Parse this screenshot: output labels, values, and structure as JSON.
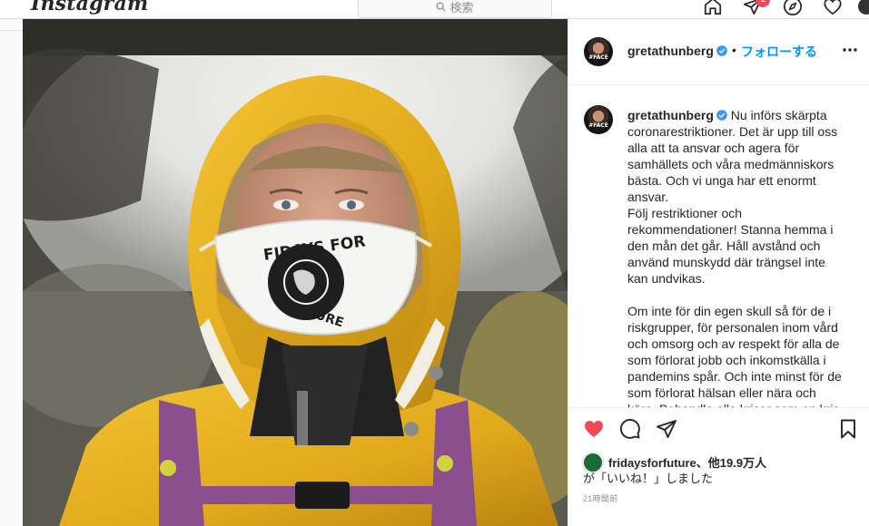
{
  "nav": {
    "logo": "Instagram",
    "search_placeholder": "検索",
    "notification_count": "1",
    "icons": [
      "home-icon",
      "direct-icon",
      "explore-icon",
      "activity-heart-icon",
      "profile-avatar"
    ]
  },
  "post": {
    "username": "gretathunberg",
    "verified": true,
    "dot": "•",
    "follow_label": "フォローする",
    "avatar_tag": "#FACE",
    "caption": "Nu införs skärpta coronarestriktioner. Det är upp till oss alla att ta ansvar och agera för samhällets och våra medmänniskors bästa. Och vi unga har ett enormt ansvar.\nFölj restriktioner och rekommendationer! Stanna hemma i den mån det går. Håll avstånd och använd munskydd där trängsel inte kan undvikas.\n\nOm inte för din egen skull så för de i riskgrupper, för personalen inom vård och omsorg och av respekt för alla de som förlorat jobb och inkomstkälla i pandemins spår. Och inte minst för de som förlorat hälsan eller nära och kära. Behandla alla kriser som en kris.",
    "mask_text_top": "FIDAYS FOR",
    "mask_text_bottom": "FUTURE",
    "liked_by_name": "fridaysforfuture",
    "liked_by_rest": "、他19.9万人",
    "liked_line2": "が「いいね！」しました",
    "time_ago": "21時間前",
    "colors": {
      "link": "#0095f6",
      "like": "#ed4956",
      "verified": "#3897f0"
    }
  }
}
